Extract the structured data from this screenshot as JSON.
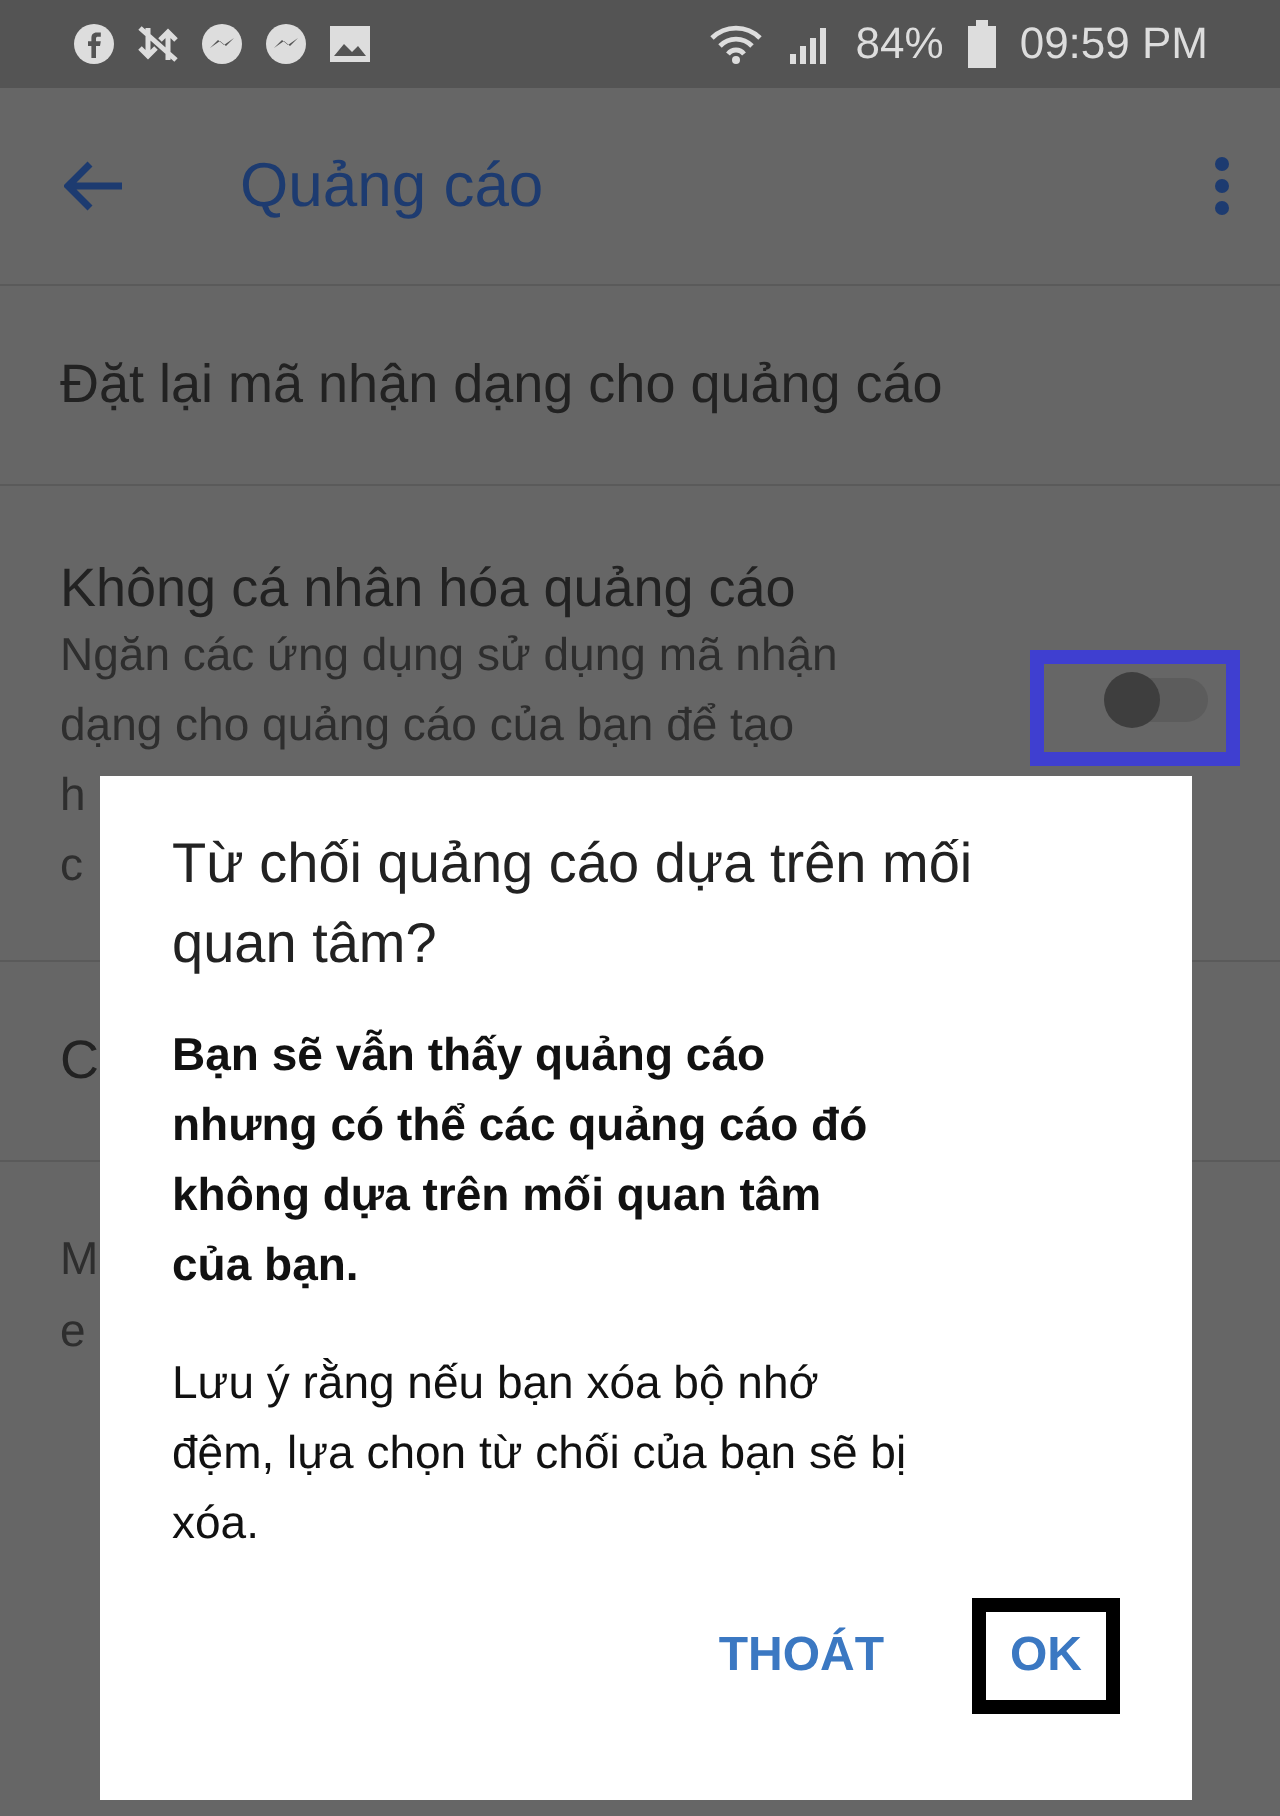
{
  "status_bar": {
    "battery": "84%",
    "time": "09:59 PM"
  },
  "toolbar": {
    "title": "Quảng cáo"
  },
  "settings": [
    {
      "kind": "action",
      "title": "Đặt lại mã nhận dạng cho quảng cáo"
    },
    {
      "kind": "toggle",
      "title": "Không cá nhân hóa quảng cáo",
      "description": [
        "Ngăn các ứng dụng sử dụng mã nhận",
        "dạng cho quảng cáo của bạn để tạo",
        "h",
        "c"
      ],
      "on": false
    },
    {
      "kind": "action",
      "title": "C"
    }
  ],
  "footer": [
    "M",
    "e"
  ],
  "dialog": {
    "title": "Từ chối quảng cáo dựa trên mối quan tâm?",
    "message": "Bạn sẽ vẫn thấy quảng cáo nhưng có thể các quảng cáo đó không dựa trên mối quan tâm của bạn.",
    "note": "Lưu ý rằng nếu bạn xóa bộ nhớ đệm, lựa chọn từ chối của bạn sẽ bị xóa.",
    "buttons": [
      {
        "label": "THOÁT",
        "highlighted": false
      },
      {
        "label": "OK",
        "highlighted": true
      }
    ]
  },
  "toggle_highlighted": true
}
